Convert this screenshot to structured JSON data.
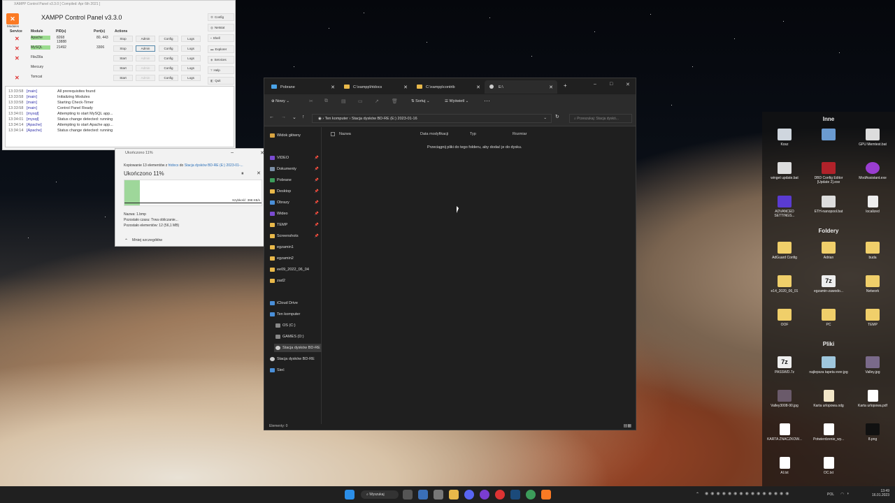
{
  "xampp": {
    "title_bar": "XAMPP Control Panel v3.3.0   [ Compiled: Apr 6th 2021 ]",
    "panel_title": "XAMPP Control Panel v3.3.0",
    "modules_label": "Modules",
    "headers": {
      "service": "Service",
      "module": "Module",
      "pid": "PID(s)",
      "port": "Port(s)",
      "actions": "Actions"
    },
    "rows": [
      {
        "module": "Apache",
        "pid": "8268\n13888",
        "port": "80, 443",
        "start": "Stop",
        "admin": "Admin",
        "config": "Config",
        "logs": "Logs"
      },
      {
        "module": "MySQL",
        "pid": "21492",
        "port": "3306",
        "start": "Stop",
        "admin": "Admin",
        "config": "Config",
        "logs": "Logs"
      },
      {
        "module": "FileZilla",
        "pid": "",
        "port": "",
        "start": "Start",
        "admin": "Admin",
        "config": "Config",
        "logs": "Logs"
      },
      {
        "module": "Mercury",
        "pid": "",
        "port": "",
        "start": "Start",
        "admin": "Admin",
        "config": "Config",
        "logs": "Logs"
      },
      {
        "module": "Tomcat",
        "pid": "",
        "port": "",
        "start": "Start",
        "admin": "Admin",
        "config": "Config",
        "logs": "Logs"
      }
    ],
    "side": [
      "Config",
      "Netstat",
      "Shell",
      "Explorer",
      "Services",
      "Help",
      "Quit"
    ],
    "log": [
      {
        "t": "13:33:58",
        "s": "[main]",
        "m": "All prerequisites found"
      },
      {
        "t": "13:33:58",
        "s": "[main]",
        "m": "Initializing Modules"
      },
      {
        "t": "13:33:58",
        "s": "[main]",
        "m": "Starting Check-Timer"
      },
      {
        "t": "13:33:58",
        "s": "[main]",
        "m": "Control Panel Ready"
      },
      {
        "t": "13:34:01",
        "s": "[mysql]",
        "m": "Attempting to start MySQL app..."
      },
      {
        "t": "13:34:01",
        "s": "[mysql]",
        "m": "Status change detected: running"
      },
      {
        "t": "13:34:14",
        "s": "[Apache]",
        "m": "Attempting to start Apache app..."
      },
      {
        "t": "13:34:14",
        "s": "[Apache]",
        "m": "Status change detected: running"
      }
    ]
  },
  "copy": {
    "title": "Ukończono 11%",
    "line1_a": "Kopiowanie 13 elementów z ",
    "line1_src": "htdocs",
    "line1_b": " do ",
    "line1_dst": "Stacja dysków BD-RE (E:) 2023-01-...",
    "big": "Ukończono 11%",
    "progress": 0.11,
    "speed": "Szybkość: 398 KB/s",
    "name": "Nazwa: 1.bmp",
    "time": "Pozostało czasu: Trwa obliczanie...",
    "items": "Pozostało elementów: 12 (56,1 MB)",
    "less": "Mniej szczegółów"
  },
  "explorer": {
    "tabs": [
      "Pobrane",
      "C:\\xampp\\htdocs",
      "C:\\xampp\\contrib",
      "E:\\"
    ],
    "toolbar": {
      "new": "Nowy",
      "sort": "Sortuj",
      "view": "Wyświetl"
    },
    "breadcrumb": [
      "Ten komputer",
      "Stacja dysków BD-RE (E:) 2023-01-16"
    ],
    "search_placeholder": "Przeszukaj: Stacja dyskó...",
    "nav": [
      "Widok główny",
      "VIDEO",
      "Dokumenty",
      "Pobrane",
      "Desktop",
      "Obrazy",
      "Wideo",
      "TEMP",
      "Screenshots",
      "egzamin1",
      "egzamin2",
      "ee09_2022_06_04",
      "zad2",
      "iCloud Drive",
      "Ten komputer",
      "OS (C:)",
      "GAMES (D:)",
      "Stacja dysków BD-RE",
      "Stacja dysków BD-RE",
      "Sieć"
    ],
    "columns": [
      "Nazwa",
      "Data modyfikacji",
      "Typ",
      "Rozmiar"
    ],
    "empty": "Przeciągnij pliki do tego folderu, aby dodać je do dysku.",
    "status": "Elementy: 0"
  },
  "desktop": {
    "sections": [
      "Inne",
      "Foldery",
      "Pliki"
    ],
    "inne": [
      "Kosz",
      "",
      "GPU Memtest.bat",
      "winget update.bat",
      "DBD Config Editor [Update 2].exe",
      "ModAssistant.exe",
      "ADVANCED SETTINGS...",
      "ETH-nanopool.bat",
      "localized"
    ],
    "foldery": [
      "AdGuard Config",
      "Adrian",
      "buda",
      "e14_2020_06_01",
      "egzamin-zawodo...",
      "Network",
      "OOF",
      "PC",
      "TEMP"
    ],
    "pliki": [
      "PASSWD.7z",
      "najlepsza tapeta ever.jpg",
      "Valley.jpg",
      "Valley3008-90.jpg",
      "Karta urlopowa.odg",
      "Karta urlopowa.pdf",
      "KARTA ZNACZKOW...",
      "Potwierdzenie_wy...",
      "8.png",
      "AI.txt",
      "OC.txt"
    ]
  },
  "taskbar": {
    "search": "Wyszukaj",
    "lang": "POL",
    "time": "13:49",
    "date": "16.01.2023"
  }
}
